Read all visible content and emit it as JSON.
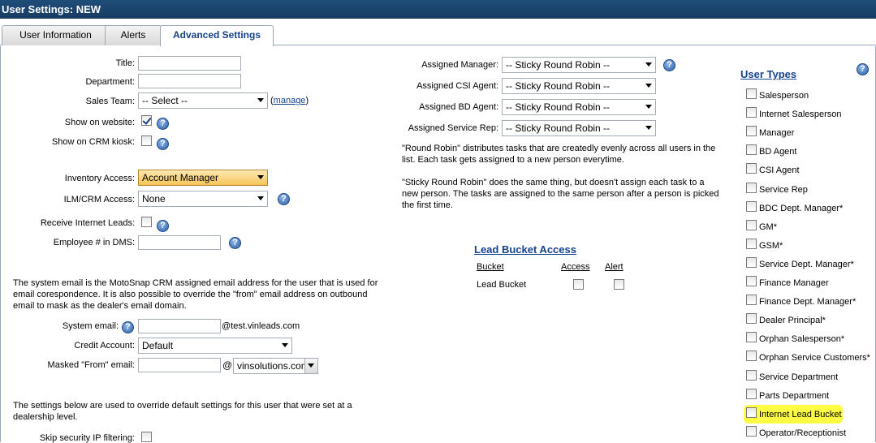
{
  "window": {
    "title": "User Settings: NEW"
  },
  "tabs": [
    {
      "label": "User Information"
    },
    {
      "label": "Alerts"
    },
    {
      "label": "Advanced Settings"
    }
  ],
  "left": {
    "title_label": "Title:",
    "department_label": "Department:",
    "sales_team_label": "Sales Team:",
    "sales_team_value": "-- Select --",
    "manage_link": "manage",
    "manage_open": "(",
    "manage_close": ")",
    "show_website_label": "Show on website:",
    "show_kiosk_label": "Show on CRM kiosk:",
    "inventory_access_label": "Inventory Access:",
    "inventory_access_value": "Account Manager",
    "ilm_access_label": "ILM/CRM Access:",
    "ilm_access_value": "None",
    "receive_leads_label": "Receive Internet Leads:",
    "employee_dms_label": "Employee # in DMS:",
    "system_email_para": "The system email is the MotoSnap CRM assigned email address for the user that is used for email corespondence. It is also possible to override the \"from\" email address on outbound email to mask as the dealer's email domain.",
    "system_email_label": "System email:",
    "system_email_domain": "@test.vinleads.com",
    "credit_account_label": "Credit Account:",
    "credit_account_value": "Default",
    "masked_from_label": "Masked \"From\" email:",
    "at_sign": "@",
    "masked_domain_value": "vinsolutions.com",
    "override_para": "The settings below are used to override default settings for this user that were set at a dealership level.",
    "skip_ip_label": "Skip security IP filtering:"
  },
  "middle": {
    "assigned_manager_label": "Assigned Manager:",
    "assigned_csi_label": "Assigned CSI Agent:",
    "assigned_bd_label": "Assigned BD Agent:",
    "assigned_service_label": "Assigned Service Rep:",
    "sticky_value": "-- Sticky Round Robin --",
    "round_robin_para": "\"Round Robin\" distributes tasks that are createdly evenly across all users in the list. Each task gets assigned to a new person everytime.",
    "sticky_para": "\"Sticky Round Robin\" does the same thing, but doesn't assign each task to a new person. The tasks are assigned to the same person after a person is picked the first time.",
    "lead_bucket_header": "Lead Bucket Access",
    "col_bucket": "Bucket",
    "col_access": "Access",
    "col_alert": "Alert",
    "row_lead_bucket": "Lead Bucket"
  },
  "user_types": {
    "header": "User Types",
    "items": [
      "Salesperson",
      "Internet Salesperson",
      "Manager",
      "BD Agent",
      "CSI Agent",
      "Service Rep",
      "BDC Dept. Manager*",
      "GM*",
      "GSM*",
      "Service Dept. Manager*",
      "Finance Manager",
      "Finance Dept. Manager*",
      "Dealer Principal*",
      "Orphan Salesperson*",
      "Orphan Service Customers*",
      "Service Department",
      "Parts Department",
      "Internet Lead Bucket",
      "Operator/Receptionist"
    ]
  },
  "help_glyph": "?",
  "colors": {
    "titlebar": "#1f4d7a",
    "accent": "#15428b",
    "highlight": "#ffff44"
  }
}
